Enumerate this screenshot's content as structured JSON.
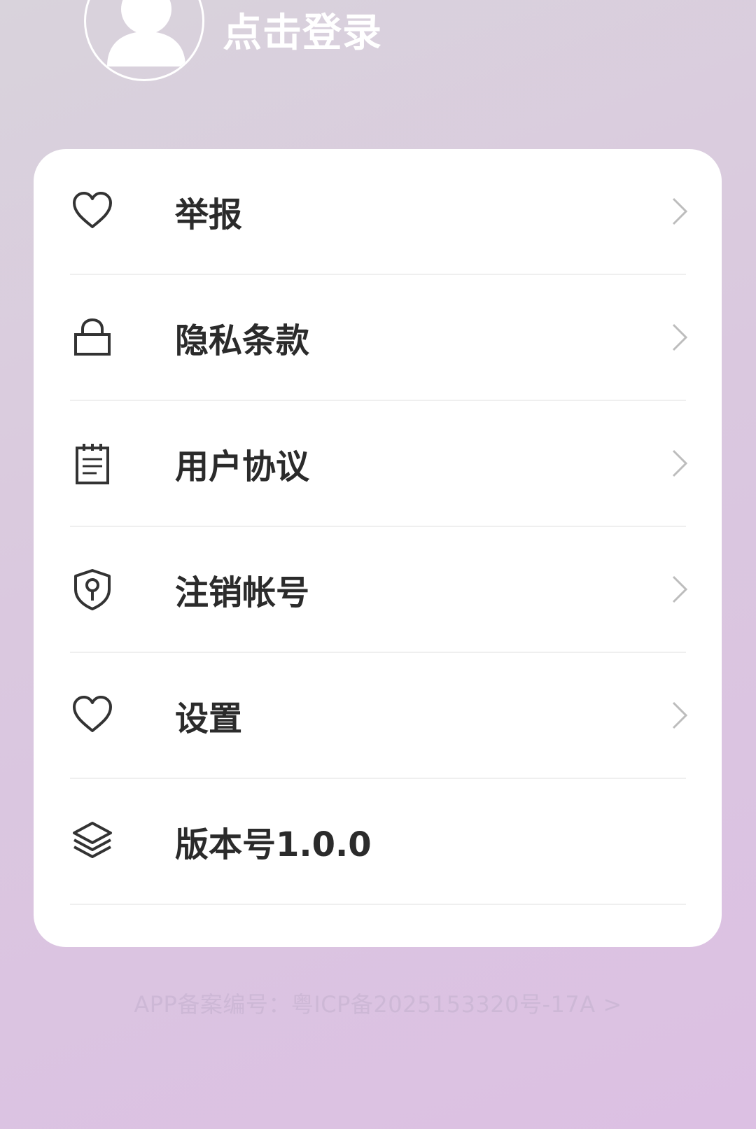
{
  "header": {
    "avatar_icon": "user-avatar-icon",
    "login_label": "点击登录"
  },
  "menu": {
    "items": [
      {
        "label": "举报",
        "icon": "heart-icon",
        "has_chevron": true
      },
      {
        "label": "隐私条款",
        "icon": "lock-icon",
        "has_chevron": true
      },
      {
        "label": "用户协议",
        "icon": "notepad-icon",
        "has_chevron": true
      },
      {
        "label": "注销帐号",
        "icon": "shield-key-icon",
        "has_chevron": true
      },
      {
        "label": "设置",
        "icon": "heart-icon",
        "has_chevron": true
      },
      {
        "label": "版本号1.0.0",
        "icon": "layers-icon",
        "has_chevron": false
      }
    ]
  },
  "footer": {
    "text": "APP备案编号：粤ICP备2025153320号-17A >"
  },
  "colors": {
    "background_top": "#d9d3dc",
    "background_bottom": "#dcc0e3",
    "card": "#ffffff",
    "label_text": "#2b2b2b",
    "chevron": "#bdbdbd",
    "footer_text": "#cdb8d6"
  }
}
